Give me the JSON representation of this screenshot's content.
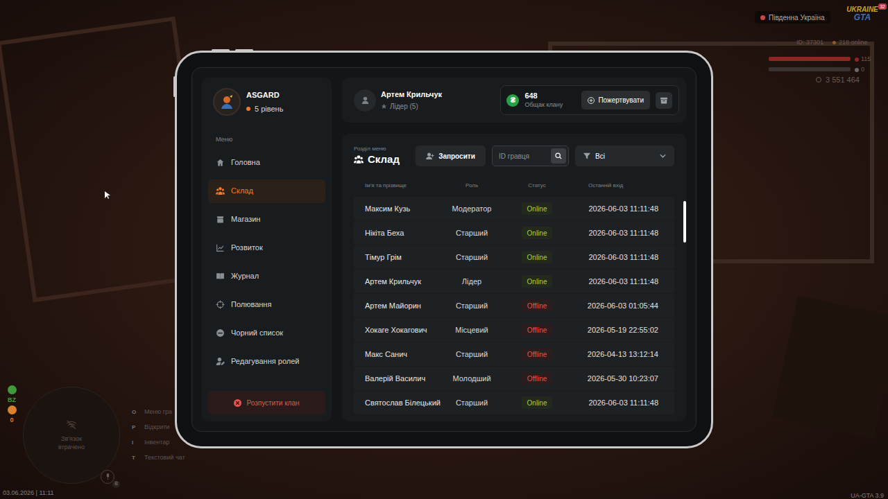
{
  "hud": {
    "region": "Південна Україна",
    "logo": [
      "UKRAINE",
      "GTA"
    ],
    "logo_badge": "32",
    "player_id": "ID: 37301",
    "online": "218 online",
    "health": {
      "reading": "115",
      "level": 1
    },
    "armor": {
      "reading": "0",
      "level": 0
    },
    "money": "3 551 464",
    "minimap_text": "Зв'язок втрачено",
    "indicators": [
      {
        "value": "BZ",
        "color": "#3f9a3a"
      },
      {
        "value": "0",
        "color": "#d9822b"
      }
    ],
    "hints": [
      {
        "key": "O",
        "label": "Меню гра"
      },
      {
        "key": "P",
        "label": "Відкрити"
      },
      {
        "key": "I",
        "label": "Інвентар"
      },
      {
        "key": "T",
        "label": "Текстовий чат"
      }
    ],
    "voice_key": "B",
    "datetime": "03.06.2026 | 11:11",
    "version": "UA-GTA 3.9"
  },
  "clan": {
    "name": "ASGARD",
    "level": "5 рівень"
  },
  "sidebar": {
    "heading": "Меню",
    "items": [
      {
        "label": "Головна",
        "selected": false
      },
      {
        "label": "Склад",
        "selected": true
      },
      {
        "label": "Магазин",
        "selected": false
      },
      {
        "label": "Розвиток",
        "selected": false
      },
      {
        "label": "Журнал",
        "selected": false
      },
      {
        "label": "Полювання",
        "selected": false
      },
      {
        "label": "Чорний список",
        "selected": false
      },
      {
        "label": "Редагування ролей",
        "selected": false
      }
    ],
    "disband_button": "Розпустити клан"
  },
  "user": {
    "name": "Артем Крильчук",
    "role": "Лідер (5)"
  },
  "treasury": {
    "currency": "₴",
    "amount": "648",
    "label": "Общак клану",
    "donate_button": "Пожертвувати"
  },
  "section": {
    "caption": "Розділ меню",
    "title": "Склад"
  },
  "invite_button": "Запросити",
  "search": {
    "placeholder": "ID гравця"
  },
  "filter": {
    "value": "Всі"
  },
  "table": {
    "columns": [
      "Ім'я та прізвище",
      "Роль",
      "Статус",
      "Останній вхід"
    ],
    "rows": [
      {
        "name": "Максим Кузь",
        "role": "Модератор",
        "status": "Online",
        "online": true,
        "last_login": "2026-06-03 11:11:48"
      },
      {
        "name": "Нікіта Беха",
        "role": "Старший",
        "status": "Online",
        "online": true,
        "last_login": "2026-06-03 11:11:48"
      },
      {
        "name": "Тімур Грім",
        "role": "Старший",
        "status": "Online",
        "online": true,
        "last_login": "2026-06-03 11:11:48"
      },
      {
        "name": "Артем Крильчук",
        "role": "Лідер",
        "status": "Online",
        "online": true,
        "last_login": "2026-06-03 11:11:48"
      },
      {
        "name": "Артем Майорин",
        "role": "Старший",
        "status": "Offline",
        "online": false,
        "last_login": "2026-06-03 01:05:44"
      },
      {
        "name": "Хокаге Хокагович",
        "role": "Місцевий",
        "status": "Offline",
        "online": false,
        "last_login": "2026-05-19 22:55:02"
      },
      {
        "name": "Макс Санич",
        "role": "Старший",
        "status": "Offline",
        "online": false,
        "last_login": "2026-04-13 13:12:14"
      },
      {
        "name": "Валерій Василич",
        "role": "Молодший",
        "status": "Offline",
        "online": false,
        "last_login": "2026-05-30 10:23:07"
      },
      {
        "name": "Святослав Білецький",
        "role": "Старший",
        "status": "Online",
        "online": true,
        "last_login": "2026-06-03 11:11:48"
      }
    ]
  }
}
